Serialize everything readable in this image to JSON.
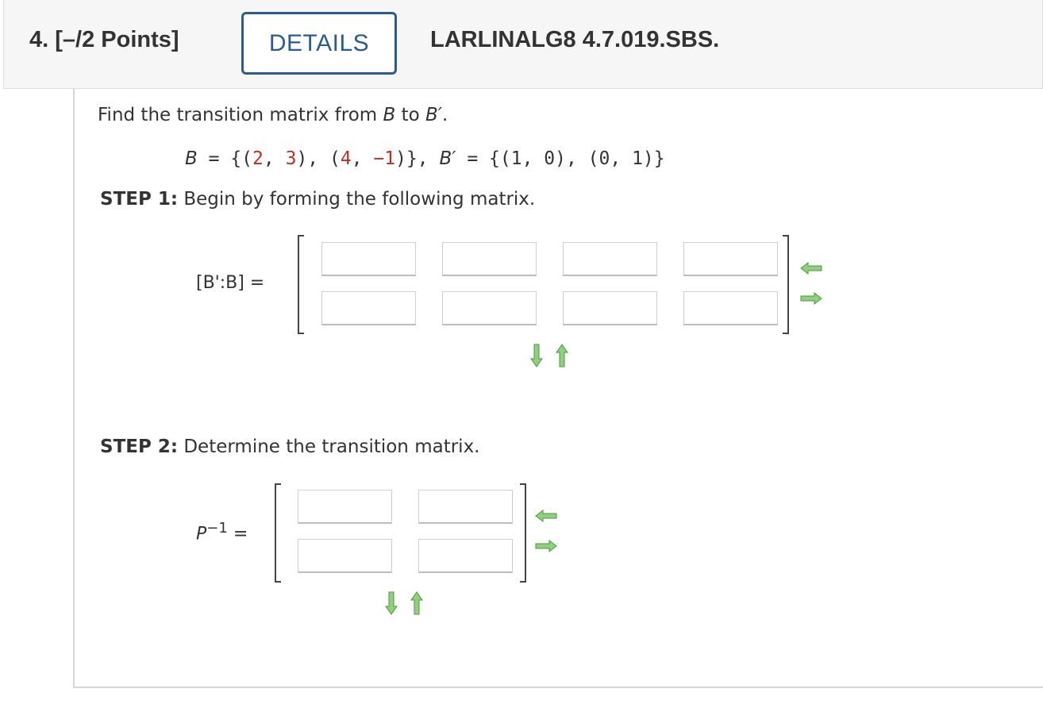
{
  "header": {
    "question_number": "4.",
    "points": "[–/2 Points]",
    "details_button": "DETAILS",
    "question_code": "LARLINALG8 4.7.019.SBS."
  },
  "problem": {
    "prompt_prefix": "Find the transition matrix from ",
    "prompt_b": "B",
    "prompt_mid": " to ",
    "prompt_bprime": "B′",
    "prompt_end": ".",
    "bases": {
      "b_label": "B",
      "eq1": " = {(",
      "v1a": "2",
      "c1": ", ",
      "v1b": "3",
      "p1": "), (",
      "v2a": "4",
      "c2": ", ",
      "v2b": "−1",
      "p2": ")}, ",
      "bprime_label": "B′",
      "rest": " = {(1, 0), (0, 1)}"
    }
  },
  "step1": {
    "label": "STEP 1:",
    "text": " Begin by forming the following matrix.",
    "matrix_label": "[B':B] =",
    "rows": 2,
    "cols": 4,
    "values": [
      [
        "",
        "",
        "",
        ""
      ],
      [
        "",
        "",
        "",
        ""
      ]
    ]
  },
  "step2": {
    "label": "STEP 2:",
    "text": " Determine the transition matrix.",
    "matrix_label_base": "P",
    "matrix_label_sup": "−1",
    "matrix_label_eq": "=",
    "rows": 2,
    "cols": 2,
    "values": [
      [
        "",
        ""
      ],
      [
        "",
        ""
      ]
    ]
  },
  "icons": {
    "remove_column": "arrow-left-icon",
    "add_column": "arrow-right-icon",
    "add_row": "arrow-down-icon",
    "remove_row": "arrow-up-icon"
  },
  "colors": {
    "accent": "#2b5c91",
    "highlight_red": "#c62d1f",
    "arrow_green": "#5aa64a"
  }
}
